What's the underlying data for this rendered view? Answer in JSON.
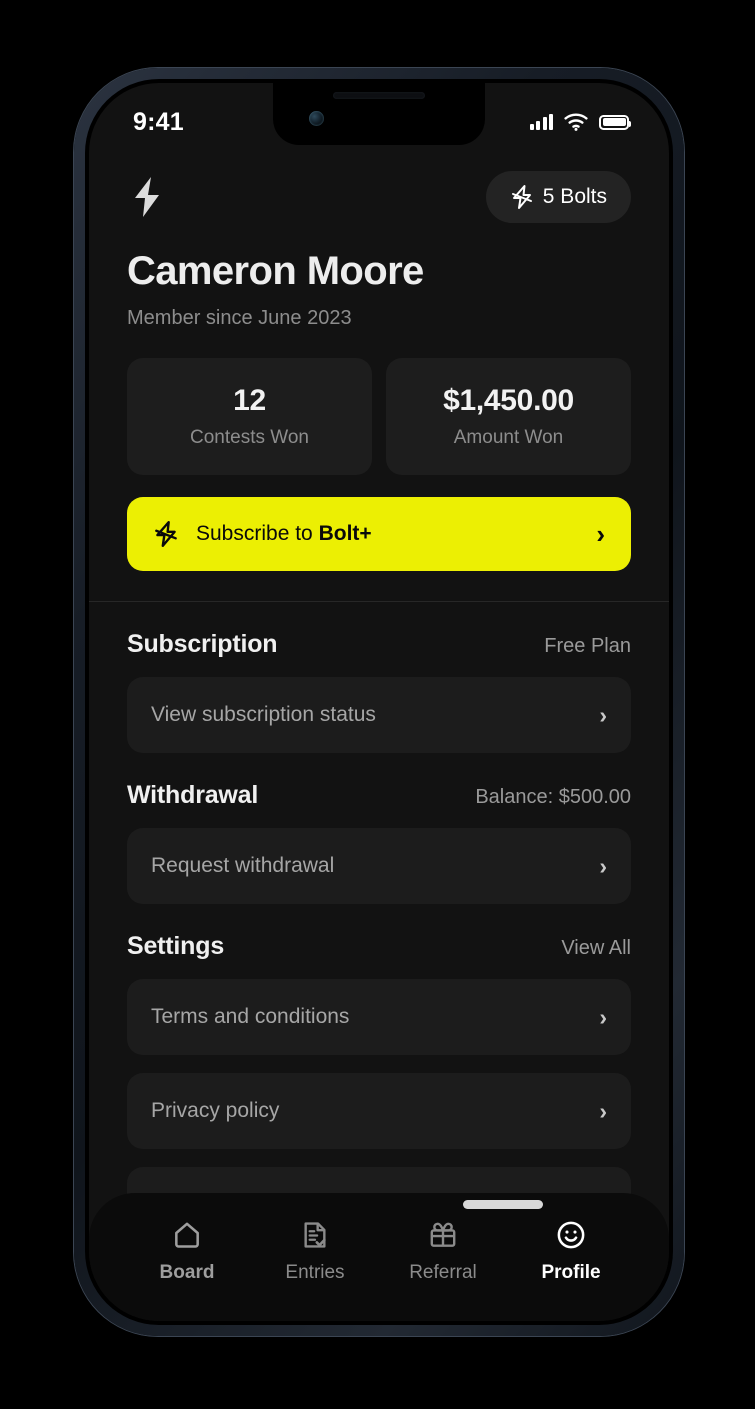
{
  "status_bar": {
    "time": "9:41",
    "signal_icon": "cellular-signal-icon",
    "wifi_icon": "wifi-icon",
    "battery_icon": "battery-full-icon"
  },
  "header": {
    "logo_icon": "bolt-logo-icon",
    "bolts_pill": {
      "icon": "bolt-outline-icon",
      "label": "5 Bolts"
    }
  },
  "profile": {
    "name": "Cameron Moore",
    "member_since": "Member since June 2023"
  },
  "stats": [
    {
      "value": "12",
      "label": "Contests Won"
    },
    {
      "value": "$1,450.00",
      "label": "Amount Won"
    }
  ],
  "cta": {
    "icon": "bolt-outline-icon",
    "text_prefix": "Subscribe to ",
    "text_bold": "Bolt+",
    "chevron": "›",
    "background_color": "#ECEF03"
  },
  "sections": [
    {
      "title": "Subscription",
      "meta": "Free Plan",
      "rows": [
        {
          "label": "View subscription status",
          "chevron": "›"
        }
      ]
    },
    {
      "title": "Withdrawal",
      "meta": "Balance: $500.00",
      "rows": [
        {
          "label": "Request withdrawal",
          "chevron": "›"
        }
      ]
    },
    {
      "title": "Settings",
      "meta": "View All",
      "rows": [
        {
          "label": "Terms and conditions",
          "chevron": "›"
        },
        {
          "label": "Privacy policy",
          "chevron": "›"
        }
      ]
    }
  ],
  "tabbar": {
    "tabs": [
      {
        "label": "Board",
        "icon": "home-icon",
        "active": false
      },
      {
        "label": "Entries",
        "icon": "entries-icon",
        "active": false
      },
      {
        "label": "Referral",
        "icon": "gift-icon",
        "active": false
      },
      {
        "label": "Profile",
        "icon": "smiley-icon",
        "active": true
      }
    ]
  },
  "theme": {
    "page_background": "#121212",
    "card_background": "#1c1c1c",
    "accent": "#ECEF03",
    "text_primary": "#f0f0f0",
    "text_muted": "#8d8d8d"
  }
}
